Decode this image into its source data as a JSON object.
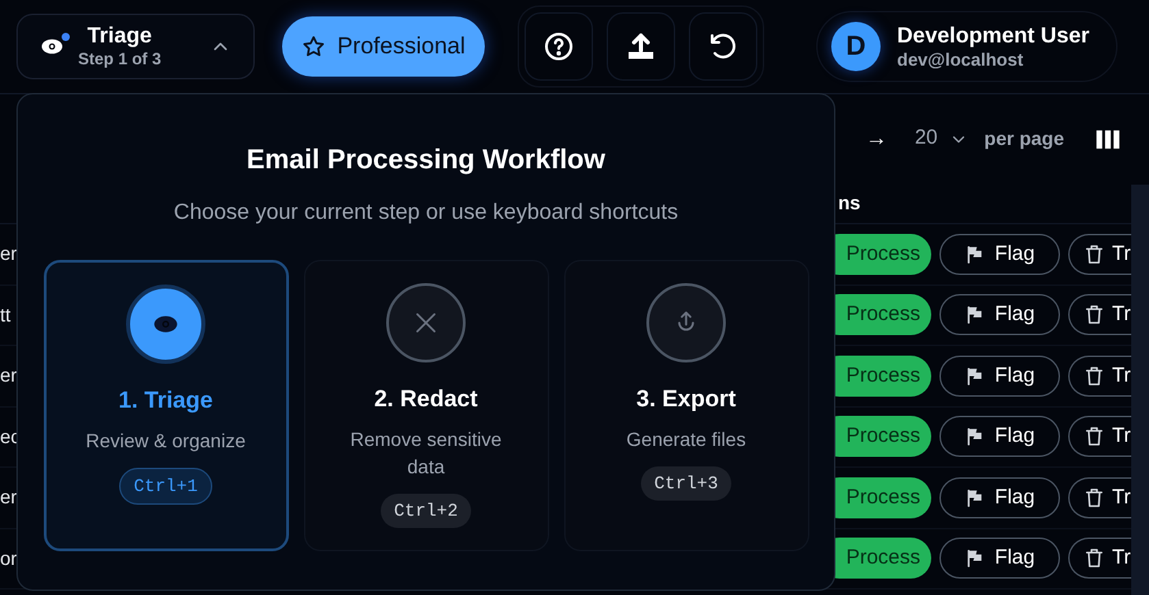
{
  "header": {
    "step_menu": {
      "title": "Triage",
      "subtitle": "Step 1 of 3",
      "expanded": true
    },
    "plan_badge": "Professional",
    "user": {
      "initial": "D",
      "name": "Development User",
      "email": "dev@localhost"
    }
  },
  "pagination": {
    "arrow": "→",
    "page_size": "20",
    "label": "per page"
  },
  "table": {
    "header_fragment": "ns",
    "rows": [
      {
        "fragment": "er",
        "actions": [
          {
            "kind": "process",
            "label": "Process"
          },
          {
            "kind": "flag",
            "label": "Flag"
          },
          {
            "kind": "trash",
            "label": "Tr"
          }
        ]
      },
      {
        "fragment": "tt",
        "actions": [
          {
            "kind": "process",
            "label": "Process"
          },
          {
            "kind": "flag",
            "label": "Flag"
          },
          {
            "kind": "trash",
            "label": "Tr"
          }
        ]
      },
      {
        "fragment": "er",
        "actions": [
          {
            "kind": "process",
            "label": "Process"
          },
          {
            "kind": "flag",
            "label": "Flag"
          },
          {
            "kind": "trash",
            "label": "Tr"
          }
        ]
      },
      {
        "fragment": "ec",
        "actions": [
          {
            "kind": "process",
            "label": "Process"
          },
          {
            "kind": "flag",
            "label": "Flag"
          },
          {
            "kind": "trash",
            "label": "Tr"
          }
        ]
      },
      {
        "fragment": "er",
        "actions": [
          {
            "kind": "process",
            "label": "Process"
          },
          {
            "kind": "flag",
            "label": "Flag"
          },
          {
            "kind": "trash",
            "label": "Tr"
          }
        ]
      },
      {
        "fragment": "or",
        "actions": [
          {
            "kind": "process",
            "label": "Process"
          },
          {
            "kind": "flag",
            "label": "Flag"
          },
          {
            "kind": "trash",
            "label": "Tr"
          }
        ]
      }
    ]
  },
  "workflow": {
    "title": "Email Processing Workflow",
    "subtitle": "Choose your current step or use keyboard shortcuts",
    "steps": [
      {
        "kind": "triage",
        "title": "1. Triage",
        "description": "Review & organize",
        "shortcut": "Ctrl+1",
        "selected": true
      },
      {
        "kind": "redact",
        "title": "2. Redact",
        "description": "Remove sensitive data",
        "shortcut": "Ctrl+2",
        "selected": false
      },
      {
        "kind": "export",
        "title": "3. Export",
        "description": "Generate files",
        "shortcut": "Ctrl+3",
        "selected": false
      }
    ]
  }
}
